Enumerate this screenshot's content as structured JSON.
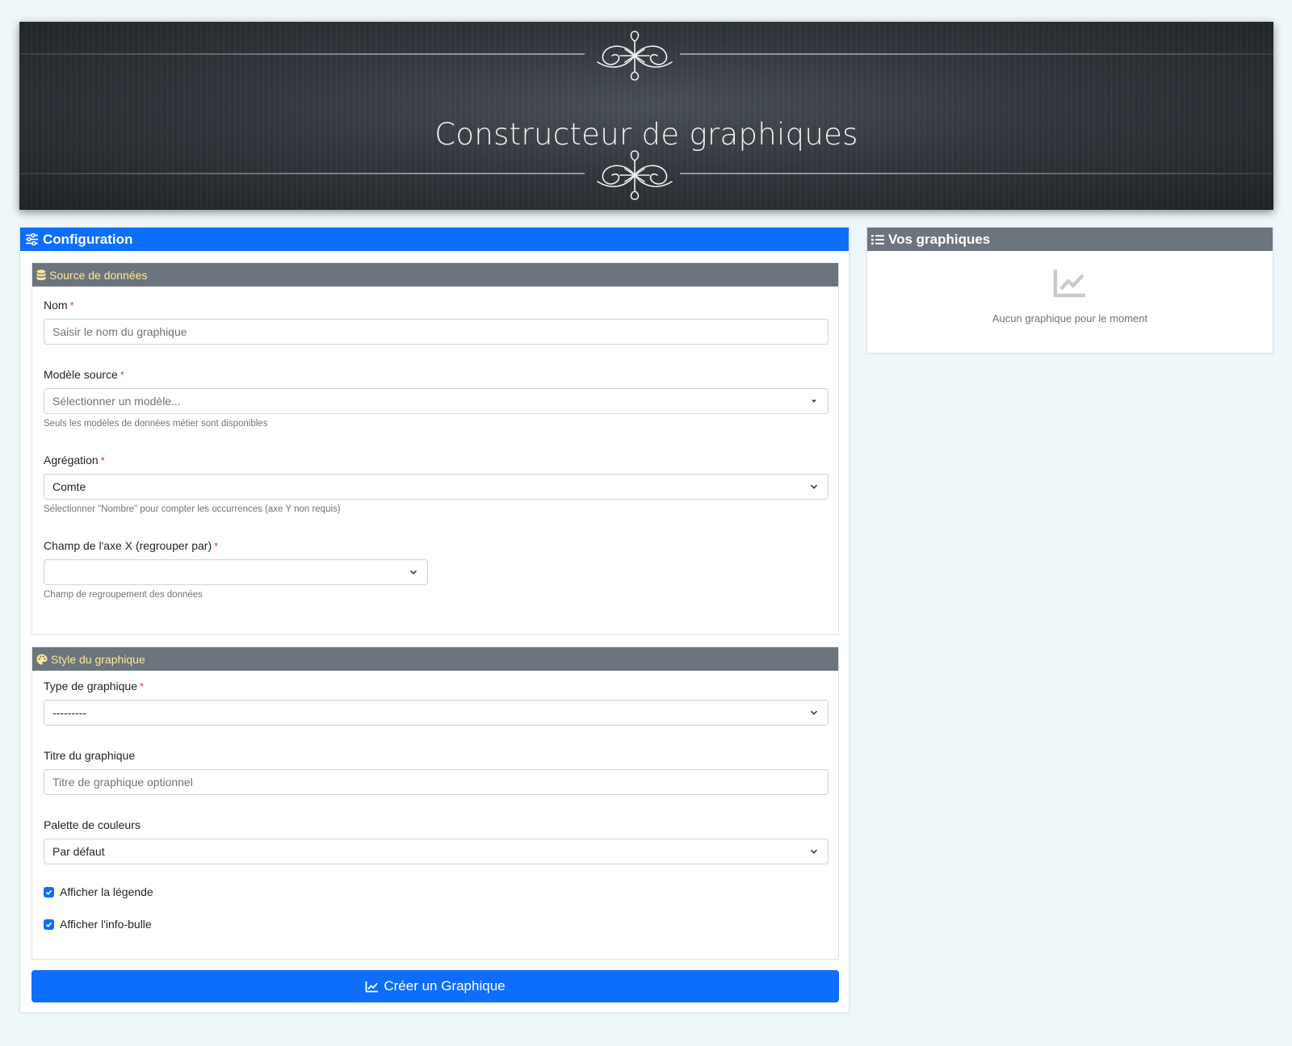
{
  "banner": {
    "title": "Constructeur de graphiques"
  },
  "config": {
    "header": "Configuration",
    "header_icon": "sliders-icon",
    "data_source": {
      "header": "Source de données",
      "header_icon": "database-icon",
      "name_field": {
        "label": "Nom",
        "required_mark": "*",
        "placeholder": "Saisir le nom du graphique"
      },
      "source_model": {
        "label": "Modèle source",
        "required_mark": "*",
        "placeholder": "Sélectionner un modèle...",
        "help": "Seuls les modèles de données métier sont disponibles"
      },
      "aggregation": {
        "label": "Agrégation",
        "required_mark": "*",
        "value": "Comte",
        "help": "Sélectionner \"Nombre\" pour compter les occurrences (axe Y non requis)"
      },
      "x_axis": {
        "label": "Champ de l'axe X (regrouper par)",
        "required_mark": "*",
        "value": "",
        "help": "Champ de regroupement des données"
      }
    },
    "chart_style": {
      "header": "Style du graphique",
      "header_icon": "palette-icon",
      "chart_type": {
        "label": "Type de graphique",
        "required_mark": "*",
        "value": "---------"
      },
      "chart_title": {
        "label": "Titre du graphique",
        "placeholder": "Titre de graphique optionnel"
      },
      "palette": {
        "label": "Palette de couleurs",
        "value": "Par défaut"
      },
      "show_legend": {
        "label": "Afficher la légende",
        "checked": true
      },
      "show_tooltip": {
        "label": "Afficher l'info-bulle",
        "checked": true
      }
    },
    "create_button": {
      "label": "Créer un Graphique",
      "icon": "chart-line-icon"
    }
  },
  "graphs": {
    "header": "Vos graphiques",
    "header_icon": "list-icon",
    "empty_icon": "chart-line-icon",
    "empty_text": "Aucun graphique pour le moment"
  },
  "colors": {
    "primary": "#0d6efd",
    "secondary": "#6c757d",
    "subheader_text": "#ffe699",
    "required": "#dc3545",
    "page_bg": "#eef7f9"
  }
}
